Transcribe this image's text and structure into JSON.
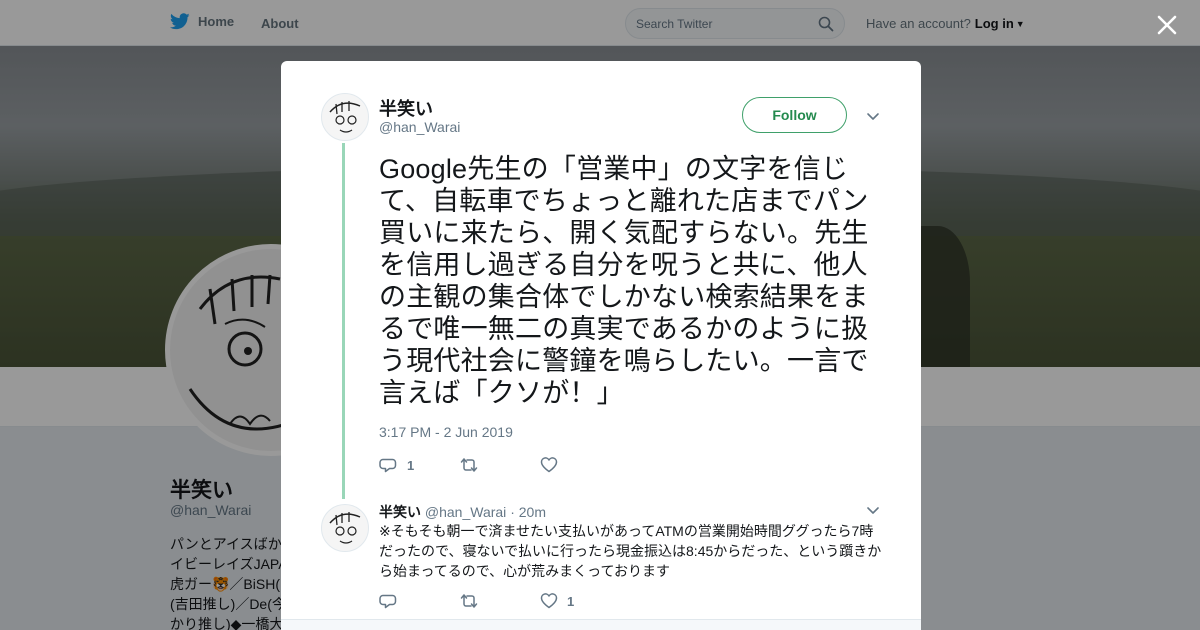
{
  "topbar": {
    "home_label": "Home",
    "about_label": "About",
    "search_placeholder": "Search Twitter",
    "account_prompt": "Have an account?",
    "login_label": "Log in"
  },
  "profile": {
    "name": "半笑い",
    "handle": "@han_Warai",
    "bio_lines": [
      "パンとアイスばか",
      "イビーレイズJAPA",
      "虎ガー🐯／BiSH(",
      "(吉田推し)／De(今",
      "かり推し)◆一橋大"
    ]
  },
  "tweet": {
    "author_name": "半笑い",
    "author_handle": "@han_Warai",
    "follow_label": "Follow",
    "text": "Google先生の「営業中」の文字を信じて、自転車でちょっと離れた店までパン買いに来たら、開く気配すらない。先生を信用し過ぎる自分を呪うと共に、他人の主観の集合体でしかない検索結果をまるで唯一無二の真実であるかのように扱う現代社会に警鐘を鳴らしたい。一言で言えば「クソが！」",
    "timestamp": "3:17 PM - 2 Jun 2019",
    "reply_count": "1",
    "retweet_count": "",
    "like_count": ""
  },
  "reply": {
    "author_name": "半笑い",
    "author_handle": "@han_Warai",
    "separator": "·",
    "time": "20m",
    "text": "※そもそも朝一で済ませたい支払いがあってATMの営業開始時間ググったら7時だったので、寝ないで払いに行ったら現金振込は8:45からだった、という躓きから始まってるので、心が荒みまくっております",
    "reply_count": "",
    "retweet_count": "",
    "like_count": "1"
  },
  "icons": {
    "brand": "twitter-bird-icon",
    "search": "search-icon",
    "close": "close-icon",
    "chevron": "chevron-down-icon",
    "reply": "reply-icon",
    "retweet": "retweet-icon",
    "like": "heart-icon"
  },
  "colors": {
    "brand_blue": "#1da1f2",
    "follow_green": "#248a4e",
    "thread_line": "#99d6b8",
    "muted_text": "#657786"
  }
}
